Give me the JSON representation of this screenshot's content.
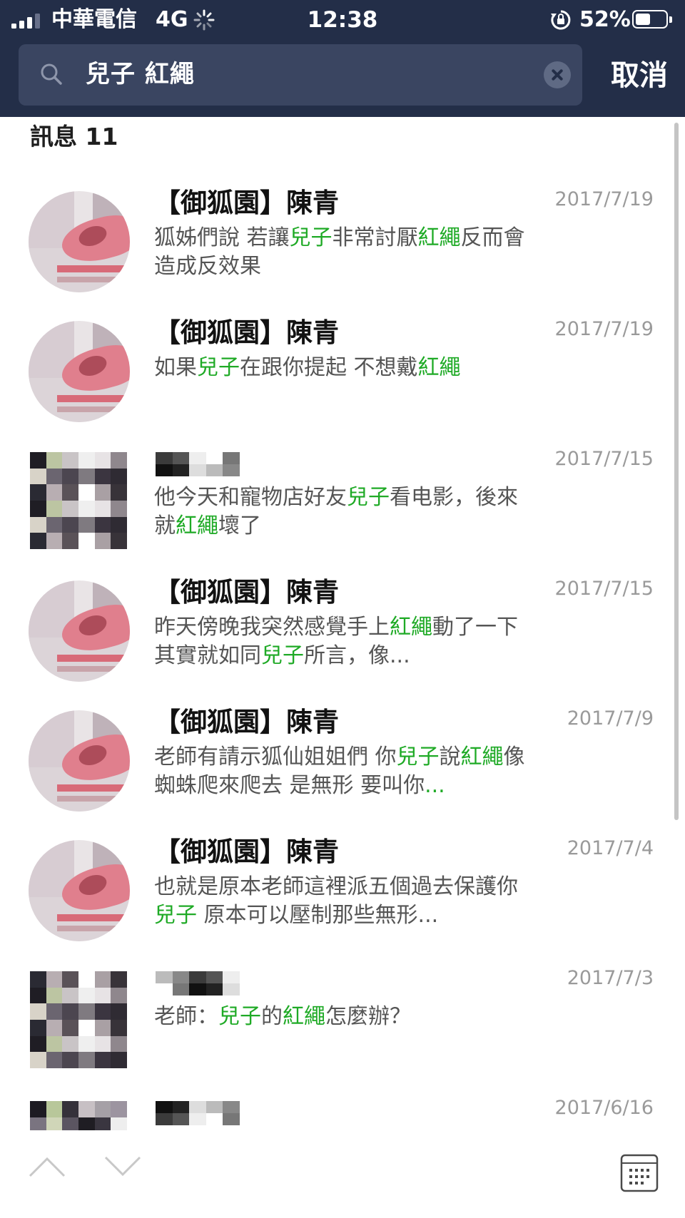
{
  "status_bar": {
    "carrier": "中華電信",
    "network": "4G",
    "time": "12:38",
    "battery": "52%",
    "battery_level": 0.52
  },
  "search": {
    "query": "兒子 紅繩",
    "cancel_label": "取消"
  },
  "results": {
    "header": "訊息 11",
    "highlight_color": "#1faa26",
    "items": [
      {
        "name": "【御狐園】陳青",
        "date": "2017/7/19",
        "avatar": "photo",
        "preview": [
          {
            "t": "狐姊們說 若讓",
            "hl": false
          },
          {
            "t": "兒子",
            "hl": true
          },
          {
            "t": "非常討厭",
            "hl": false
          },
          {
            "t": "紅繩",
            "hl": true
          },
          {
            "t": "反而會造成反效果",
            "hl": false
          }
        ]
      },
      {
        "name": "【御狐園】陳青",
        "date": "2017/7/19",
        "avatar": "photo",
        "preview": [
          {
            "t": "如果",
            "hl": false
          },
          {
            "t": "兒子",
            "hl": true
          },
          {
            "t": "在跟你提起 不想戴",
            "hl": false
          },
          {
            "t": "紅繩",
            "hl": true
          }
        ]
      },
      {
        "name": "",
        "date": "2017/7/15",
        "avatar": "pixelated",
        "preview": [
          {
            "t": "他今天和寵物店好友",
            "hl": false
          },
          {
            "t": "兒子",
            "hl": true
          },
          {
            "t": "看电影，後來就",
            "hl": false
          },
          {
            "t": "紅繩",
            "hl": true
          },
          {
            "t": "壞了",
            "hl": false
          }
        ]
      },
      {
        "name": "【御狐園】陳青",
        "date": "2017/7/15",
        "avatar": "photo",
        "preview": [
          {
            "t": "昨天傍晚我突然感覺手上",
            "hl": false
          },
          {
            "t": "紅繩",
            "hl": true
          },
          {
            "t": "動了一下  其實就如同",
            "hl": false
          },
          {
            "t": "兒子",
            "hl": true
          },
          {
            "t": "所言，像...",
            "hl": false
          }
        ]
      },
      {
        "name": "【御狐園】陳青",
        "date": "2017/7/9",
        "avatar": "photo",
        "preview": [
          {
            "t": "老師有請示狐仙姐姐們 你",
            "hl": false
          },
          {
            "t": "兒子",
            "hl": true
          },
          {
            "t": "說",
            "hl": false
          },
          {
            "t": "紅繩",
            "hl": true
          },
          {
            "t": "像蜘蛛爬來爬去 是無形 要叫你",
            "hl": false
          },
          {
            "t": "...",
            "hl": true
          }
        ]
      },
      {
        "name": "【御狐園】陳青",
        "date": "2017/7/4",
        "avatar": "photo",
        "preview": [
          {
            "t": "也就是原本老師這裡派五個過去保護你",
            "hl": false
          },
          {
            "t": "兒子",
            "hl": true
          },
          {
            "t": " 原本可以壓制那些無形...",
            "hl": false
          }
        ]
      },
      {
        "name": "",
        "date": "2017/7/3",
        "avatar": "pixelated",
        "preview": [
          {
            "t": "老師：",
            "hl": false
          },
          {
            "t": "兒子",
            "hl": true
          },
          {
            "t": "的",
            "hl": false
          },
          {
            "t": "紅繩",
            "hl": true
          },
          {
            "t": "怎麼辦？",
            "hl": false
          }
        ]
      },
      {
        "name": "",
        "date": "2017/6/16",
        "avatar": "pixelated",
        "preview": []
      }
    ]
  },
  "bottom_bar": {
    "icons": [
      "chevron-up-icon",
      "chevron-down-icon",
      "calendar-icon"
    ]
  }
}
